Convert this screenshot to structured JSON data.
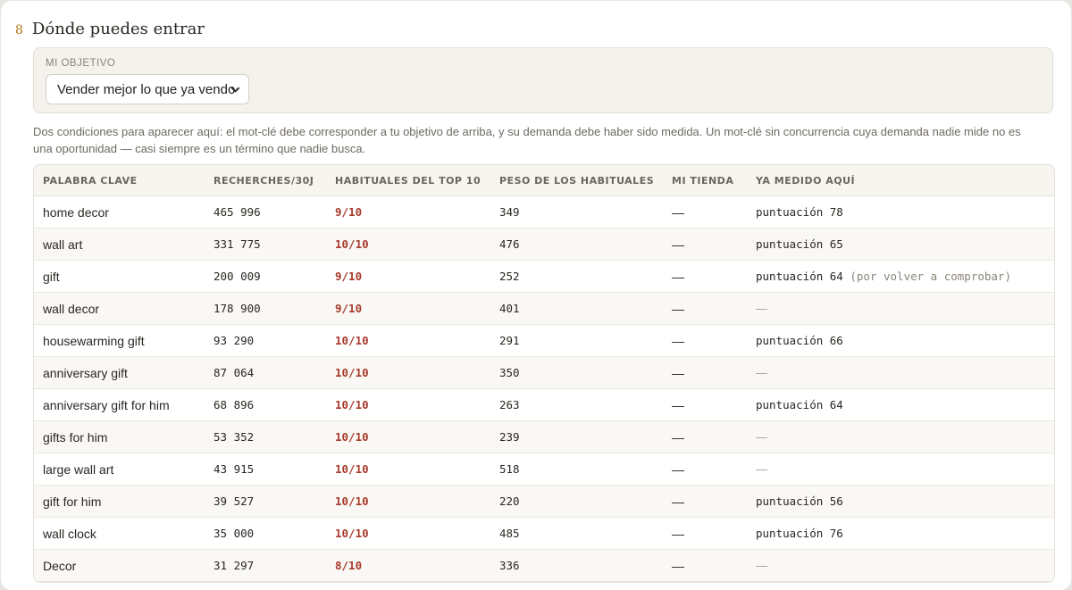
{
  "section": {
    "number": "8",
    "title": "Dónde puedes entrar"
  },
  "objective": {
    "label": "MI OBJETIVO",
    "selected": "Vender mejor lo que ya vendo"
  },
  "description": "Dos condiciones para aparecer aquí: el mot-clé debe corresponder a tu objetivo de arriba, y su demanda debe haber sido medida. Un mot-clé sin concurrencia cuya demanda nadie mide no es una oportunidad — casi siempre es un término que nadie busca.",
  "table": {
    "headers": {
      "keyword": "PALABRA CLAVE",
      "searches": "RECHERCHES/30J",
      "top10": "HABITUALES DEL TOP 10",
      "weight": "PESO DE LOS HABITUALES",
      "shop": "MI TIENDA",
      "measured": "YA MEDIDO AQUÍ"
    },
    "rows": [
      {
        "keyword": "home decor",
        "searches": "465 996",
        "top10": "9/10",
        "weight": "349",
        "shop": "—",
        "measured": "puntuación 78",
        "note": ""
      },
      {
        "keyword": "wall art",
        "searches": "331 775",
        "top10": "10/10",
        "weight": "476",
        "shop": "—",
        "measured": "puntuación 65",
        "note": ""
      },
      {
        "keyword": "gift",
        "searches": "200 009",
        "top10": "9/10",
        "weight": "252",
        "shop": "—",
        "measured": "puntuación 64",
        "note": " (por volver a comprobar)"
      },
      {
        "keyword": "wall decor",
        "searches": "178 900",
        "top10": "9/10",
        "weight": "401",
        "shop": "—",
        "measured": "—",
        "note": ""
      },
      {
        "keyword": "housewarming gift",
        "searches": "93 290",
        "top10": "10/10",
        "weight": "291",
        "shop": "—",
        "measured": "puntuación 66",
        "note": ""
      },
      {
        "keyword": "anniversary gift",
        "searches": "87 064",
        "top10": "10/10",
        "weight": "350",
        "shop": "—",
        "measured": "—",
        "note": ""
      },
      {
        "keyword": "anniversary gift for him",
        "searches": "68 896",
        "top10": "10/10",
        "weight": "263",
        "shop": "—",
        "measured": "puntuación 64",
        "note": ""
      },
      {
        "keyword": "gifts for him",
        "searches": "53 352",
        "top10": "10/10",
        "weight": "239",
        "shop": "—",
        "measured": "—",
        "note": ""
      },
      {
        "keyword": "large wall art",
        "searches": "43 915",
        "top10": "10/10",
        "weight": "518",
        "shop": "—",
        "measured": "—",
        "note": ""
      },
      {
        "keyword": "gift for him",
        "searches": "39 527",
        "top10": "10/10",
        "weight": "220",
        "shop": "—",
        "measured": "puntuación 56",
        "note": ""
      },
      {
        "keyword": "wall clock",
        "searches": "35 000",
        "top10": "10/10",
        "weight": "485",
        "shop": "—",
        "measured": "puntuación 76",
        "note": ""
      },
      {
        "keyword": "Decor",
        "searches": "31 297",
        "top10": "8/10",
        "weight": "336",
        "shop": "—",
        "measured": "—",
        "note": ""
      }
    ]
  }
}
